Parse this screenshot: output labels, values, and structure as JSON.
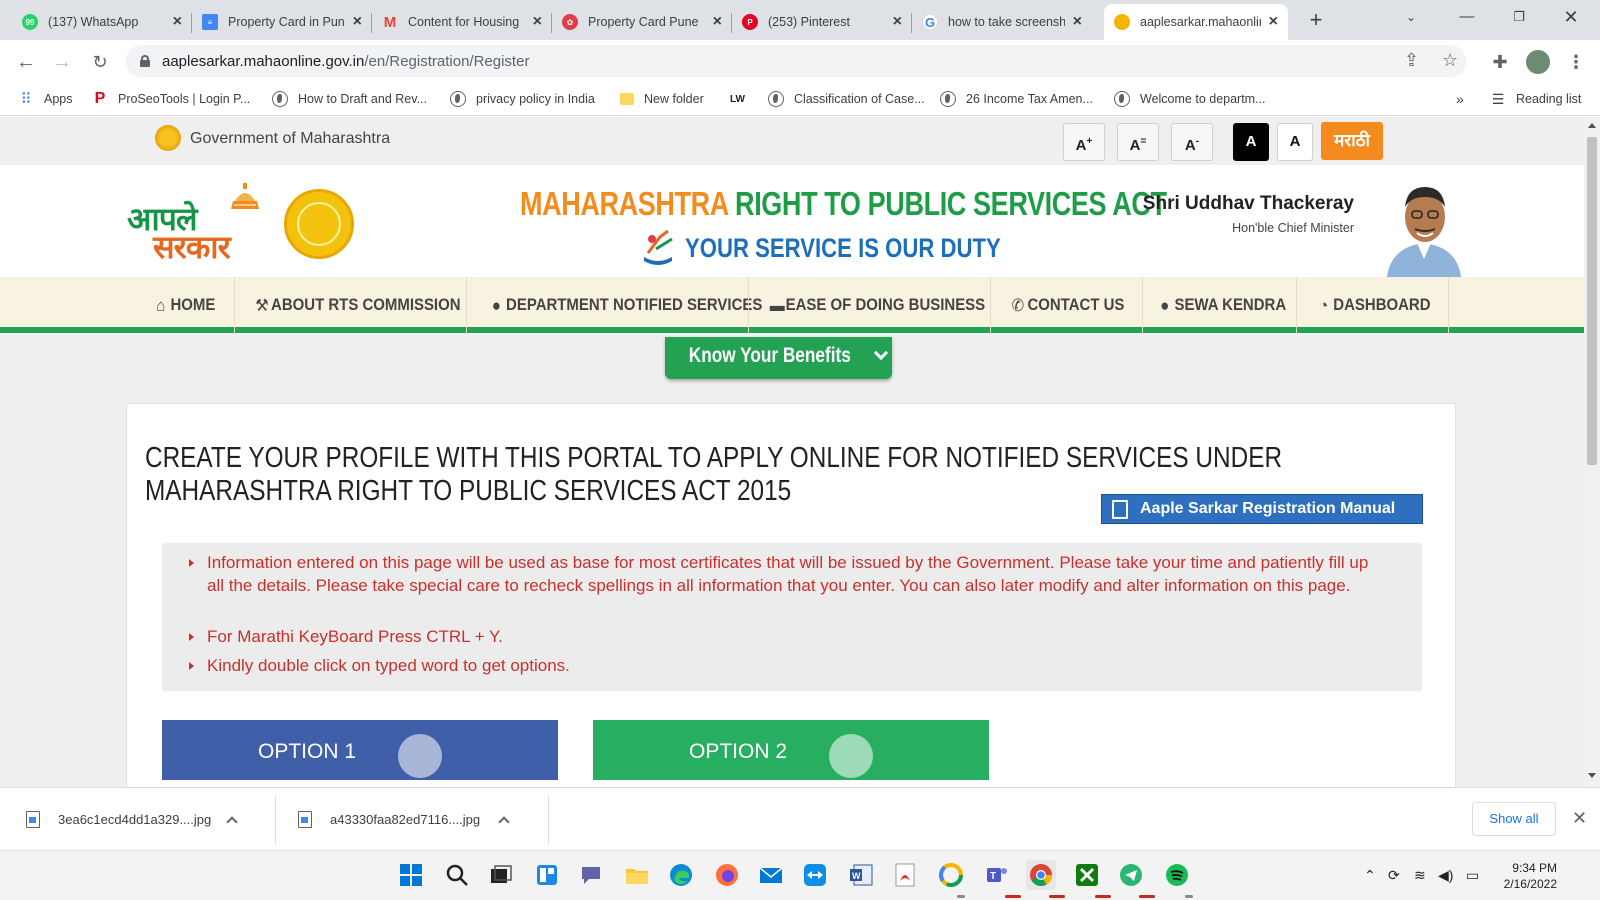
{
  "browser": {
    "tabs": [
      {
        "title": "(137) WhatsApp",
        "icon": "whatsapp-icon",
        "color": "#25d366"
      },
      {
        "title": "Property Card in Pune",
        "icon": "docs-icon",
        "color": "#4285f4"
      },
      {
        "title": "Content for Housing",
        "icon": "gmail-icon",
        "color": "#ea4335"
      },
      {
        "title": "Property Card Pune",
        "icon": "app-icon",
        "color": "#e23b4b"
      },
      {
        "title": "(253) Pinterest",
        "icon": "pinterest-icon",
        "color": "#e60023"
      },
      {
        "title": "how to take screenshot",
        "icon": "google-icon",
        "color": "#4285f4"
      },
      {
        "title": "aaplesarkar.mahaonline",
        "icon": "site-icon",
        "color": "#f4b400"
      }
    ],
    "url_domain": "aaplesarkar.mahaonline.gov.in",
    "url_path": "/en/Registration/Register",
    "bookmarks": [
      {
        "label": "Apps",
        "icon": "apps-grid-icon"
      },
      {
        "label": "ProSeoTools | Login P...",
        "icon": "pinterest-icon"
      },
      {
        "label": "How to Draft and Rev...",
        "icon": "globe-icon"
      },
      {
        "label": "privacy policy in India",
        "icon": "globe-icon"
      },
      {
        "label": "New folder",
        "icon": "folder-icon"
      },
      {
        "label": "LW",
        "icon": "lw-icon"
      },
      {
        "label": "Classification of Case...",
        "icon": "globe-icon"
      },
      {
        "label": "26 Income Tax Amen...",
        "icon": "globe-icon"
      },
      {
        "label": "Welcome to departm...",
        "icon": "globe-icon"
      }
    ],
    "bookmarks_more": "»",
    "reading_list": "Reading list"
  },
  "site": {
    "gov_name": "Government of Maharashtra",
    "font_controls": {
      "larger": "A",
      "larger_sup": "+",
      "normal": "A",
      "normal_sup": "=",
      "smaller": "A",
      "smaller_sup": "-"
    },
    "contrast_dark": "A",
    "contrast_light": "A",
    "language_button": "मराठी",
    "logo_line1": "आपले",
    "logo_line2": "सरकार",
    "act_title_orange": "MAHARASHTRA ",
    "act_title_green": "RIGHT TO PUBLIC SERVICES ACT",
    "tagline": "YOUR SERVICE IS OUR DUTY",
    "cm_name": "Shri Uddhav Thackeray",
    "cm_title": "Hon'ble Chief Minister",
    "nav": [
      {
        "label": "HOME",
        "icon": "home-icon"
      },
      {
        "label": "ABOUT RTS COMMISSION",
        "icon": "gavel-icon"
      },
      {
        "label": "DEPARTMENT NOTIFIED SERVICES",
        "icon": "user-icon"
      },
      {
        "label": "EASE OF DOING BUSINESS",
        "icon": "briefcase-icon"
      },
      {
        "label": "CONTACT US",
        "icon": "phone-icon"
      },
      {
        "label": "SEWA KENDRA",
        "icon": "user-icon"
      },
      {
        "label": "DASHBOARD",
        "icon": "dashboard-icon"
      }
    ],
    "know_benefits": "Know Your Benefits",
    "heading": "CREATE YOUR PROFILE WITH THIS PORTAL TO APPLY ONLINE FOR NOTIFIED SERVICES UNDER MAHARASHTRA RIGHT TO PUBLIC SERVICES ACT 2015",
    "manual_button": "Aaple Sarkar Registration Manual",
    "info": [
      "Information entered on this page will be used as base for most certificates that will be issued by the Government. Please take your time and patiently fill up all the details. Please take special care to recheck spellings in all information that you enter. You can also later modify and alter information on this page.",
      "For Marathi KeyBoard Press CTRL + Y.",
      "Kindly double click on typed word to get options."
    ],
    "option1": "OPTION 1",
    "option2": "OPTION 2",
    "colors": {
      "orange": "#f28c1c",
      "green": "#23a253",
      "blue": "#1e6fb9",
      "option1": "#3f5fa8",
      "option2": "#27ae60",
      "info_red": "#c9302c"
    }
  },
  "downloads": {
    "items": [
      "3ea6c1ecd4dd1a329....jpg",
      "a43330faa82ed7116....jpg"
    ],
    "show_all": "Show all"
  },
  "taskbar": {
    "time": "9:34 PM",
    "date": "2/16/2022"
  }
}
